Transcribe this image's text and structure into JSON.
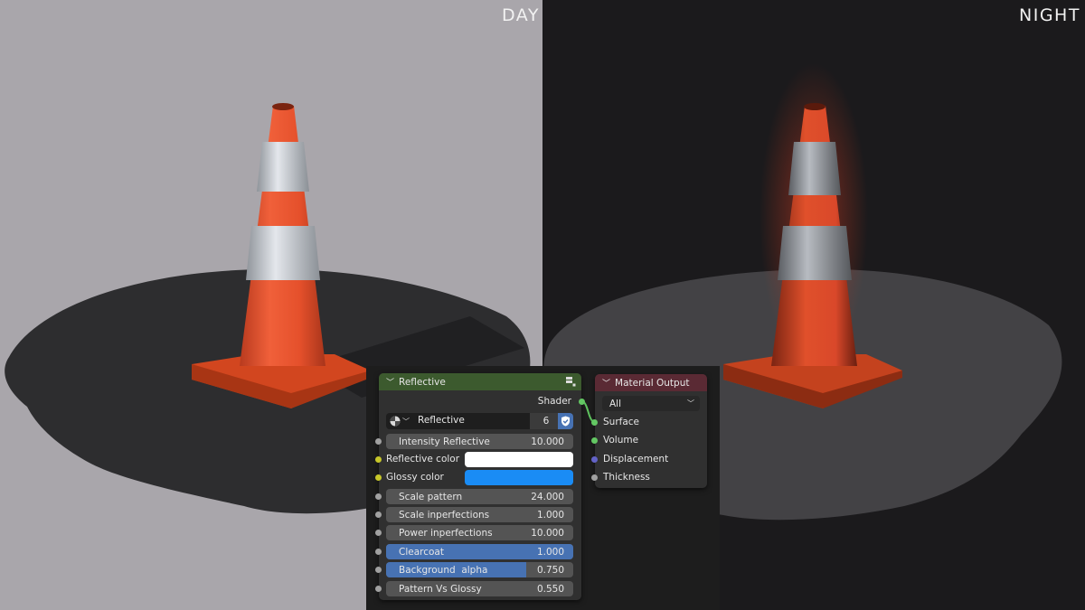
{
  "viewport": {
    "left_label": "DAY",
    "right_label": "NIGHT"
  },
  "colors": {
    "day_background": "#a9a6ab",
    "night_background": "#1b1a1c",
    "cone_orange": "#e8532c",
    "reflective_band": "#c9cdd4",
    "asphalt": "#2a2a2c",
    "node_body": "#303030",
    "reflective_header": "#3c5a2e",
    "material_output_header": "#5a2a34",
    "slider_blue": "#4772b3",
    "reflective_color": "#ffffff",
    "glossy_color": "#1a8cf5"
  },
  "reflective_node": {
    "title": "Reflective",
    "header_icon": "node-group-icon",
    "output_label": "Shader",
    "group_selector": {
      "type_icon": "sphere-material-icon",
      "name": "Reflective",
      "users": "6",
      "fake_user_icon": "shield-check-icon"
    },
    "inputs": [
      {
        "label": "Intensity Reflective",
        "value": "10.000",
        "kind": "field",
        "fill": 0,
        "socket": "gray"
      },
      {
        "label": "Reflective color",
        "kind": "color",
        "color": "#ffffff",
        "socket": "yellow"
      },
      {
        "label": "Glossy color",
        "kind": "color",
        "color": "#1a8cf5",
        "socket": "yellow"
      },
      {
        "label": "Scale pattern",
        "value": "24.000",
        "kind": "field",
        "fill": 0,
        "socket": "gray"
      },
      {
        "label": "Scale inperfections",
        "value": "1.000",
        "kind": "field",
        "fill": 0,
        "socket": "gray"
      },
      {
        "label": "Power inperfections",
        "value": "10.000",
        "kind": "field",
        "fill": 0,
        "socket": "gray"
      },
      {
        "label": "Clearcoat",
        "value": "1.000",
        "kind": "field",
        "fill": 1.0,
        "socket": "gray"
      },
      {
        "label": "Background  alpha",
        "value": "0.750",
        "kind": "field",
        "fill": 0.75,
        "socket": "gray"
      },
      {
        "label": "Pattern Vs Glossy",
        "value": "0.550",
        "kind": "field",
        "fill": 0,
        "socket": "gray"
      }
    ]
  },
  "material_output_node": {
    "title": "Material Output",
    "target": "All",
    "inputs": [
      {
        "label": "Surface",
        "socket": "green"
      },
      {
        "label": "Volume",
        "socket": "green"
      },
      {
        "label": "Displacement",
        "socket": "purple"
      },
      {
        "label": "Thickness",
        "socket": "gray"
      }
    ]
  }
}
